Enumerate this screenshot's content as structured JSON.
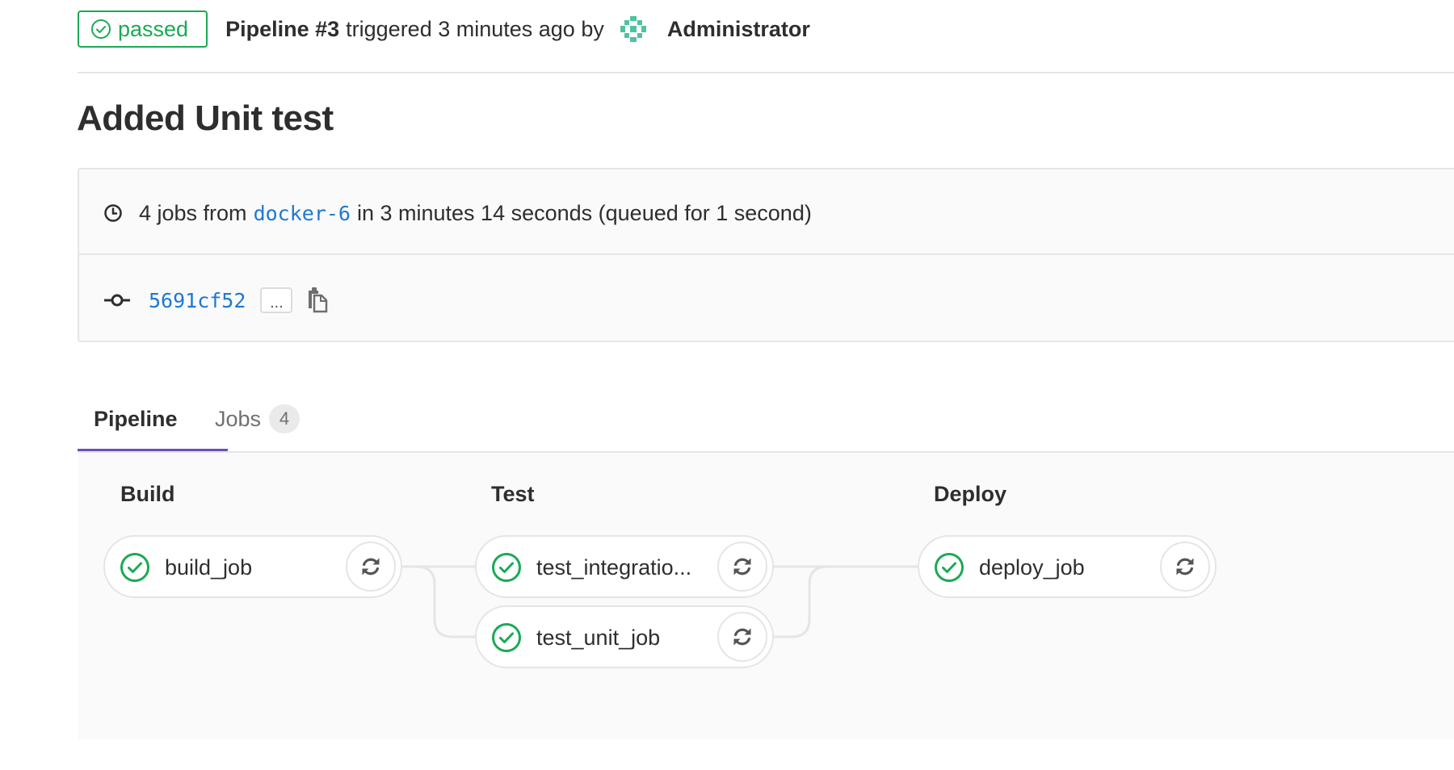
{
  "header": {
    "status_label": "passed",
    "pipeline_ref": "Pipeline #3",
    "triggered_text": "triggered 3 minutes ago by",
    "author": "Administrator"
  },
  "title": "Added Unit test",
  "info": {
    "jobs_count_text": "4 jobs from",
    "runner": "docker-6",
    "duration_text": "in 3 minutes 14 seconds (queued for 1 second)",
    "commit_sha": "5691cf52",
    "ellipsis_label": "..."
  },
  "tabs": [
    {
      "label": "Pipeline",
      "active": true
    },
    {
      "label": "Jobs",
      "count": "4",
      "active": false
    }
  ],
  "pipeline": {
    "stages": [
      {
        "title": "Build",
        "jobs": [
          {
            "name": "build_job",
            "status": "passed"
          }
        ]
      },
      {
        "title": "Test",
        "jobs": [
          {
            "name": "test_integratio...",
            "status": "passed"
          },
          {
            "name": "test_unit_job",
            "status": "passed"
          }
        ]
      },
      {
        "title": "Deploy",
        "jobs": [
          {
            "name": "deploy_job",
            "status": "passed"
          }
        ]
      }
    ]
  },
  "colors": {
    "success": "#1aaa55",
    "link": "#1f78d1",
    "active_tab": "#6b4fbb",
    "border": "#e5e5e5"
  },
  "icons": {
    "status": "check-circle-icon",
    "retry": "retry-icon",
    "clock": "clock-icon",
    "commit": "commit-icon",
    "copy": "clipboard-icon",
    "avatar": "identicon-avatar"
  }
}
